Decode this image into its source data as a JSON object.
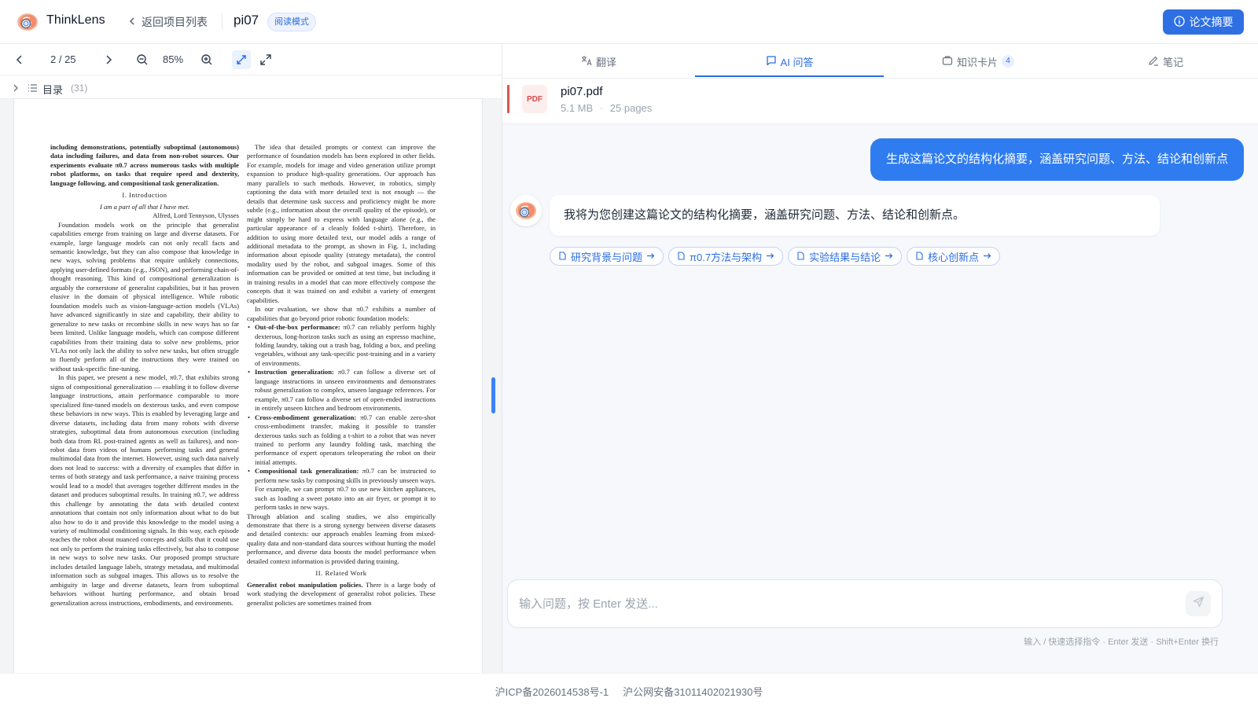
{
  "header": {
    "app_name": "ThinkLens",
    "back_label": "返回项目列表",
    "doc_title": "pi07",
    "mode_badge": "阅读模式",
    "summary_button": "论文摘要",
    "accent_color": "#2f6fe4"
  },
  "viewer": {
    "page_indicator": "2 / 25",
    "zoom": "85%",
    "toc_label": "目录",
    "toc_count": "(31)",
    "page": {
      "left_column": {
        "abstract_tail": "including demonstrations, potentially suboptimal (autonomous) data including failures, and data from non-robot sources. Our experiments evaluate π0.7 across numerous tasks with multiple robot platforms, on tasks that require speed and dexterity, language following, and compositional task generalization.",
        "heading_intro": "I. Introduction",
        "epigraph": "I am a part of all that I have met.",
        "epigraph_author": "Alfred, Lord Tennyson, Ulysses",
        "para1": "Foundation models work on the principle that generalist capabilities emerge from training on large and diverse datasets. For example, large language models can not only recall facts and semantic knowledge, but they can also compose that knowledge in new ways, solving problems that require unlikely connections, applying user-defined formats (e.g., JSON), and performing chain-of-thought reasoning. This kind of compositional generalization is arguably the cornerstone of generalist capabilities, but it has proven elusive in the domain of physical intelligence. While robotic foundation models such as vision-language-action models (VLAs) have advanced significantly in size and capability, their ability to generalize to new tasks or recombine skills in new ways has so far been limited. Unlike language models, which can compose different capabilities from their training data to solve new problems, prior VLAs not only lack the ability to solve new tasks, but often struggle to fluently perform all of the instructions they were trained on without task-specific fine-tuning.",
        "para2": "In this paper, we present a new model, π0.7, that exhibits strong signs of compositional generalization — enabling it to follow diverse language instructions, attain performance comparable to more specialized fine-tuned models on dexterous tasks, and even compose these behaviors in new ways. This is enabled by leveraging large and diverse datasets, including data from many robots with diverse strategies, suboptimal data from autonomous execution (including both data from RL post-trained agents as well as failures), and non-robot data from videos of humans performing tasks and general multimodal data from the internet. However, using such data naively does not lead to success: with a diversity of examples that differ in terms of both strategy and task performance, a naive training process would lead to a model that averages together different modes in the dataset and produces suboptimal results. In training π0.7, we address this challenge by annotating the data with detailed context annotations that contain not only information about what to do but also how to do it and provide this knowledge to the model using a variety of multimodal conditioning signals. In this way, each episode teaches the robot about nuanced concepts and skills that it could use not only to perform the training tasks effectively, but also to compose in new ways to solve new tasks. Our proposed prompt structure includes detailed language labels, strategy metadata, and multimodal information such as subgoal images. This allows us to resolve the ambiguity in large and diverse datasets, learn from suboptimal behaviors without hurting performance, and obtain broad generalization across instructions, embodiments, and environments."
      },
      "right_column": {
        "para1": "The idea that detailed prompts or context can improve the performance of foundation models has been explored in other fields. For example, models for image and video generation utilize prompt expansion to produce high-quality generations. Our approach has many parallels to such methods. However, in robotics, simply captioning the data with more detailed text is not enough — the details that determine task success and proficiency might be more subtle (e.g., information about the overall quality of the episode), or might simply be hard to express with language alone (e.g., the particular appearance of a cleanly folded t-shirt). Therefore, in addition to using more detailed text, our model adds a range of additional metadata to the prompt, as shown in Fig. 1, including information about episode quality (strategy metadata), the control modality used by the robot, and subgoal images. Some of this information can be provided or omitted at test time, but including it in training results in a model that can more effectively compose the concepts that it was trained on and exhibit a variety of emergent capabilities.",
        "para2": "In our evaluation, we show that π0.7 exhibits a number of capabilities that go beyond prior robotic foundation models:",
        "bullets": [
          {
            "title": "Out-of-the-box performance:",
            "text": "π0.7 can reliably perform highly dexterous, long-horizon tasks such as using an espresso machine, folding laundry, taking out a trash bag, folding a box, and peeling vegetables, without any task-specific post-training and in a variety of environments."
          },
          {
            "title": "Instruction generalization:",
            "text": "π0.7 can follow a diverse set of language instructions in unseen environments and demonstrates robust generalization to complex, unseen language references. For example, π0.7 can follow a diverse set of open-ended instructions in entirely unseen kitchen and bedroom environments."
          },
          {
            "title": "Cross-embodiment generalization:",
            "text": "π0.7 can enable zero-shot cross-embodiment transfer, making it possible to transfer dexterous tasks such as folding a t-shirt to a robot that was never trained to perform any laundry folding task, matching the performance of expert operators teleoperating the robot on their initial attempts."
          },
          {
            "title": "Compositional task generalization:",
            "text": "π0.7 can be instructed to perform new tasks by composing skills in previously unseen ways. For example, we can prompt π0.7 to use new kitchen appliances, such as loading a sweet potato into an air fryer, or prompt it to perform tasks in new ways."
          }
        ],
        "para3": "Through ablation and scaling studies, we also empirically demonstrate that there is a strong synergy between diverse datasets and detailed contexts: our approach enables learning from mixed-quality data and non-standard data sources without hurting the model performance, and diverse data boosts the model performance when detailed context information is provided during training.",
        "heading_related": "II. Related Work",
        "para4_title": "Generalist robot manipulation policies.",
        "para4": "There is a large body of work studying the development of generalist robot policies. These generalist policies are sometimes trained from"
      }
    }
  },
  "tabs": [
    {
      "label": "翻译",
      "icon": "translate-icon"
    },
    {
      "label": "AI 问答",
      "icon": "chat-icon",
      "active": true
    },
    {
      "label": "知识卡片",
      "icon": "card-icon",
      "count": "4"
    },
    {
      "label": "笔记",
      "icon": "pen-icon"
    }
  ],
  "file": {
    "icon_label": "PDF",
    "name": "pi07.pdf",
    "size": "5.1 MB",
    "pages": "25 pages"
  },
  "chat": {
    "user_message": "生成这篇论文的结构化摘要，涵盖研究问题、方法、结论和创新点",
    "ai_message": "我将为您创建这篇论文的结构化摘要，涵盖研究问题、方法、结论和创新点。",
    "sections": [
      "研究背景与问题",
      "π0.7方法与架构",
      "实验结果与结论",
      "核心创新点"
    ],
    "user_bubble_color": "#2f7cf0"
  },
  "composer": {
    "placeholder": "输入问题，按 Enter 发送...",
    "value": "",
    "hint": "输入 / 快速选择指令 · Enter 发送 · Shift+Enter 换行"
  },
  "footer": {
    "icp": "沪ICP备2026014538号-1",
    "police": "沪公网安备31011402021930号"
  }
}
